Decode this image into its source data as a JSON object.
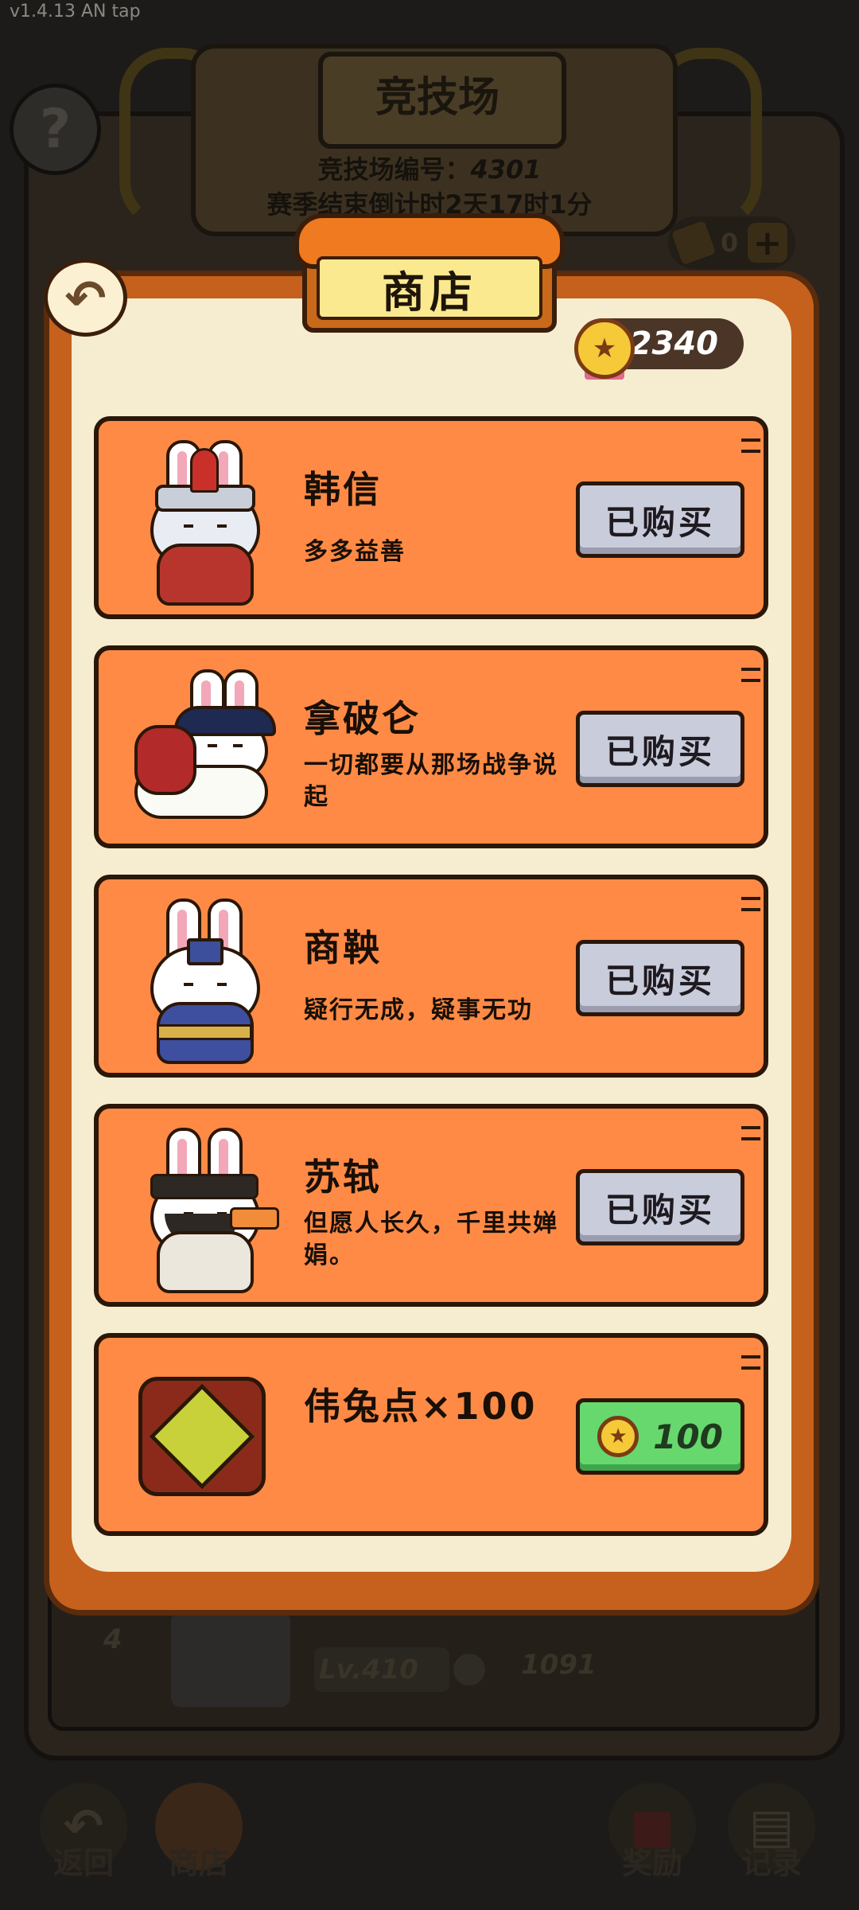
{
  "status_bar": {
    "text": "v1.4.13 AN tap"
  },
  "arena": {
    "title": "竞技场",
    "arena_number_label": "竞技场编号：",
    "arena_number": "4301",
    "season_countdown": "赛季结束倒计时2天17时1分",
    "help_icon": "?",
    "ticket_count": "0",
    "ticket_plus": "+",
    "row": {
      "rank": "4",
      "level": "Lv.410",
      "score": "1091"
    },
    "bottom_nav": [
      {
        "label": "返回",
        "icon": "back-arrow-icon"
      },
      {
        "label": "商店",
        "icon": "shop-icon"
      },
      {
        "label": "奖励",
        "icon": "gift-icon"
      },
      {
        "label": "记录",
        "icon": "clipboard-icon"
      }
    ]
  },
  "shop": {
    "title": "商店",
    "back_icon": "↶",
    "currency_amount": "2340",
    "currency_icon": "★",
    "items": [
      {
        "name": "韩信",
        "desc": "多多益善",
        "button": "已购买",
        "purchased": true
      },
      {
        "name": "拿破仑",
        "desc": "一切都要从那场战争说起",
        "button": "已购买",
        "purchased": true
      },
      {
        "name": "商鞅",
        "desc": "疑行无成，疑事无功",
        "button": "已购买",
        "purchased": true
      },
      {
        "name": "苏轼",
        "desc": "但愿人长久，千里共婵娟。",
        "button": "已购买",
        "purchased": true
      },
      {
        "name": "伟兔点×100",
        "desc": "",
        "button": "100",
        "purchased": false
      }
    ]
  },
  "colors": {
    "card_orange": "#fe8a46",
    "frame_orange": "#c5611d",
    "panel_cream": "#f6edd1",
    "sign_yellow": "#fbe990",
    "purchased_gray": "#c9ccdb",
    "buy_green": "#67d86d"
  }
}
